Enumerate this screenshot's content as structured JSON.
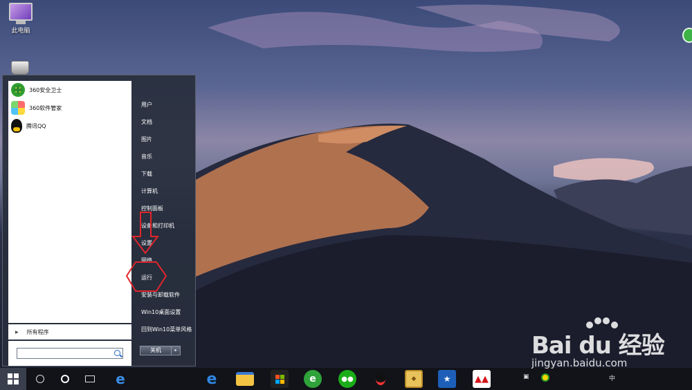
{
  "desktop": {
    "icons": [
      {
        "label": "此电脑",
        "icon": "computer-icon"
      },
      {
        "label": "",
        "icon": "recycle-bin-icon"
      }
    ]
  },
  "start_menu": {
    "programs": [
      {
        "label": "360安全卫士",
        "icon": "360-safe-icon"
      },
      {
        "label": "360软件管家",
        "icon": "360-software-manager-icon"
      },
      {
        "label": "腾讯QQ",
        "icon": "qq-icon"
      }
    ],
    "all_programs": "所有程序",
    "search": {
      "value": "",
      "icon": "search-icon"
    },
    "right_items": [
      "用户",
      "文档",
      "图片",
      "音乐",
      "下载",
      "计算机",
      "控制面板",
      "设备和打印机",
      "设置",
      "网络",
      "运行",
      "安装与卸载软件",
      "Win10桌面设置",
      "回到Win10菜单风格"
    ],
    "shutdown_label": "关机",
    "shutdown_arrow": "▸"
  },
  "annotation": {
    "highlighted_item": "运行",
    "accent_color": "#e0262c"
  },
  "taskbar": {
    "start_icon": "windows-logo-icon",
    "pinned": [
      {
        "name": "edge",
        "icon": "edge-icon"
      },
      {
        "name": "file-explorer",
        "icon": "folder-icon"
      },
      {
        "name": "store",
        "icon": "store-icon"
      },
      {
        "name": "360-browser",
        "icon": "360-browser-icon"
      },
      {
        "name": "wechat",
        "icon": "wechat-icon"
      },
      {
        "name": "qq",
        "icon": "qq-icon"
      },
      {
        "name": "app-gold",
        "icon": "gold-badge-icon"
      },
      {
        "name": "app-flag",
        "icon": "flag-app-icon"
      },
      {
        "name": "app-red",
        "icon": "red-logo-icon"
      }
    ],
    "tray_ime": "中"
  },
  "watermark": {
    "brand": "Bai du 经验",
    "url": "jingyan.baidu.com"
  }
}
